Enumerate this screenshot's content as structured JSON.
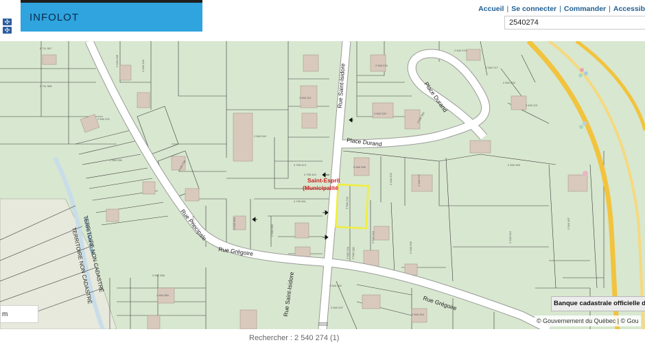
{
  "header": {
    "app_title": "INFOLOT",
    "nav": [
      "Accueil",
      "Se connecter",
      "Commander",
      "Accessib"
    ],
    "search_value": "2540274"
  },
  "map": {
    "roads": {
      "rue_saint_isidore_north": "Rue Saint-Isidore",
      "rue_saint_isidore_south": "Rue Saint-Isidore",
      "place_durand_curve": "Place Durand",
      "place_durand": "Place Durand",
      "rue_principale": "Rue Principale",
      "rue_gregoire_west": "Rue Grégoire",
      "rue_gregoire_east": "Rue Grégoire",
      "riviere": "Rivière Saint-Esprit"
    },
    "territory_labels": [
      "TERRITOIRE NON CADASTRÉ",
      "TERRITOIRE NON CADASTRÉ"
    ],
    "municipality_label": [
      "Saint-Esprit",
      "(Municipalité"
    ],
    "lot_numbers": [
      "2 540 274",
      "2 540 279",
      "2 540 280",
      "4 708 413",
      "4 708 410",
      "4 749 451",
      "2 540 211",
      "2 540 220",
      "2 540 240",
      "2 540 253",
      "2 540 300",
      "2 540 286",
      "2 540 238",
      "2 540 239",
      "2 540 215",
      "2 540 213",
      "2 540 217",
      "2 540 232",
      "2 540 221",
      "2 540 309",
      "2 540 345",
      "2 540 326",
      "2 540 271",
      "2 540 255",
      "2 540 315",
      "2 540 267",
      "2 540 299",
      "2 540 318",
      "2 540 358",
      "2 540 360",
      "6 711 507",
      "6 711 508",
      "2 540 302",
      "2 540 314",
      "2 540 297",
      "2 540 236",
      "2 540 222",
      "2 540 250"
    ],
    "selected_lot": "2 540 274",
    "scale_label": "m",
    "banque_label": "Banque cadastrale officielle d",
    "attribution": "© Gouvernement du Québec | © Gou",
    "colors": {
      "parcel_fill": "#d8e7cf",
      "road_fill": "#ffffff",
      "highway": "#f2c33d",
      "selection": "#f1ee3a",
      "river": "#c8dde9"
    }
  },
  "footer": {
    "search_result": "Rechercher : 2 540 274 (1)"
  }
}
